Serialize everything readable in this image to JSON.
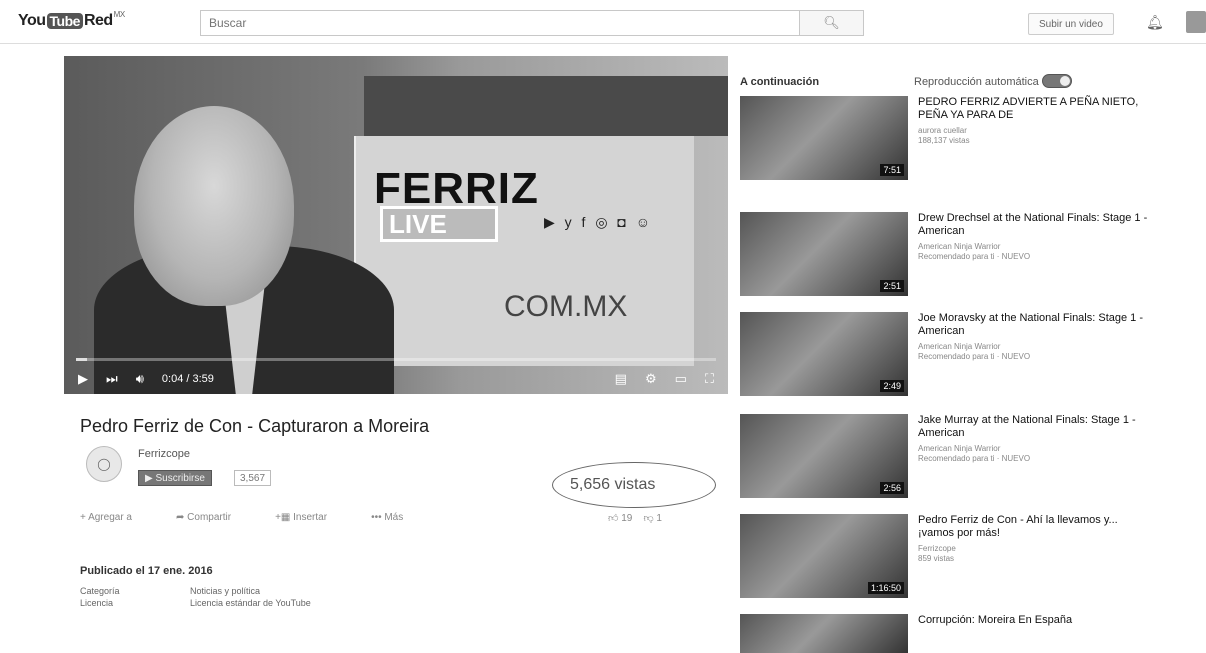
{
  "header": {
    "logo_you": "You",
    "logo_tube": "Tube",
    "logo_red": "Red",
    "logo_region": "MX",
    "search_placeholder": "Buscar",
    "upload_label": "Subir un video",
    "icons": [
      "search-icon",
      "bell-icon",
      "avatar"
    ]
  },
  "player": {
    "overlay_title": "FERRIZ",
    "overlay_live": "LIVE",
    "overlay_socials": "▶ y f ◎ ◘ ☺",
    "overlay_url": "COM.MX",
    "time": "0:04 / 3:59",
    "progress": 0.017
  },
  "video": {
    "title": "Pedro Ferriz de Con - Capturaron a Moreira",
    "channel": "Ferrizcope",
    "subscribe_label": "Suscribirse",
    "subscriber_count": "3,567",
    "views": "5,656 vistas",
    "actions": [
      "Agregar a",
      "Compartir",
      "Insertar",
      "Más"
    ],
    "likes": "19",
    "dislikes": "1",
    "published": "Publicado el 17 ene. 2016",
    "meta": [
      {
        "key": "Categoría",
        "value": "Noticias y política"
      },
      {
        "key": "Licencia",
        "value": "Licencia estándar de YouTube"
      }
    ]
  },
  "sidebar": {
    "next_label": "A continuación",
    "autoplay_label": "Reproducción automática",
    "items": [
      {
        "title": "PEDRO FERRIZ ADVIERTE A PEÑA NIETO, PEÑA YA PARA DE",
        "channel": "aurora cuellar",
        "meta": "188,137 vistas",
        "duration": "7:51"
      },
      {
        "title": "Drew Drechsel at the National Finals: Stage 1 - American",
        "channel": "American Ninja Warrior",
        "meta": "Recomendado para ti · NUEVO",
        "duration": "2:51"
      },
      {
        "title": "Joe Moravsky at the National Finals: Stage 1 - American",
        "channel": "American Ninja Warrior",
        "meta": "Recomendado para ti · NUEVO",
        "duration": "2:49"
      },
      {
        "title": "Jake Murray at the National Finals: Stage 1 - American",
        "channel": "American Ninja Warrior",
        "meta": "Recomendado para ti · NUEVO",
        "duration": "2:56"
      },
      {
        "title": "Pedro Ferriz de Con - Ahí la llevamos y... ¡vamos por más!",
        "channel": "Ferrizcope",
        "meta": "859 vistas",
        "duration": "1:16:50"
      },
      {
        "title": "Corrupción: Moreira En España",
        "channel": "",
        "meta": "",
        "duration": ""
      }
    ]
  }
}
